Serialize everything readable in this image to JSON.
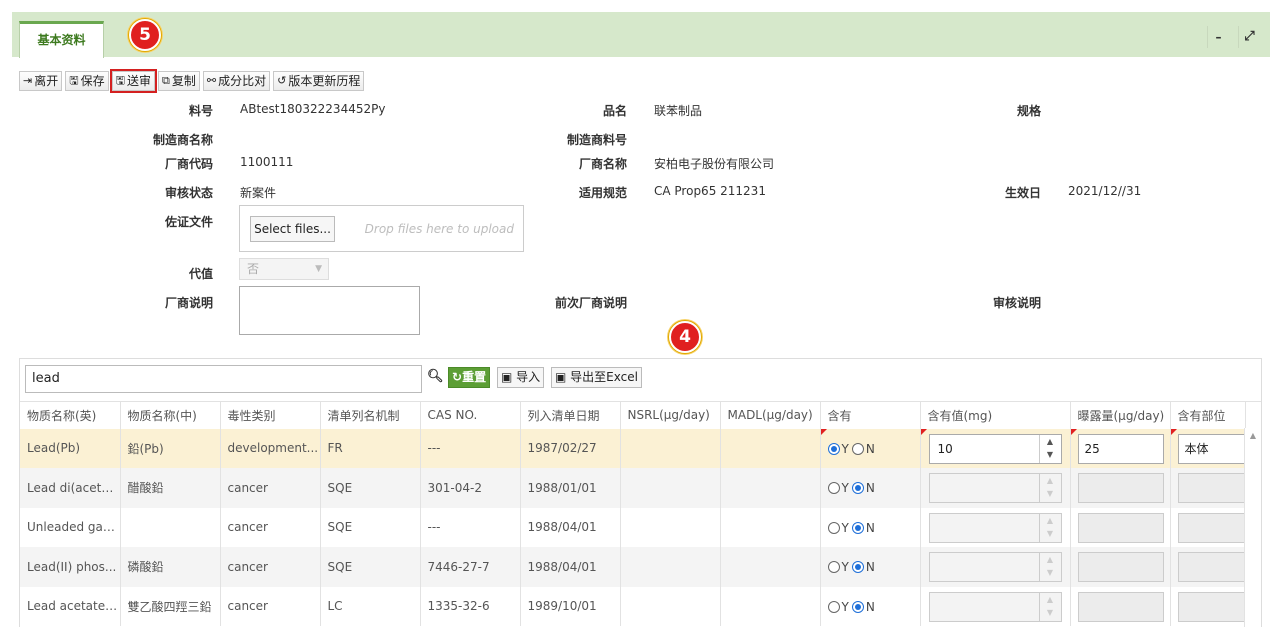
{
  "tab": {
    "label": "基本资料"
  },
  "badges": {
    "five": "5",
    "four": "4"
  },
  "window": {
    "minimize": "–",
    "maximize": "⤢"
  },
  "toolbar": {
    "leave": "离开",
    "save": "保存",
    "submit": "送审",
    "copy": "复制",
    "compare": "成分比对",
    "history": "版本更新历程"
  },
  "form": {
    "part_no_label": "料号",
    "part_no": "ABtest180322234452Py",
    "product_name_label": "品名",
    "product_name": "联苯制品",
    "spec_label": "规格",
    "maker_name_label": "制造商名称",
    "maker_part_label": "制造商料号",
    "vendor_code_label": "厂商代码",
    "vendor_code": "1100111",
    "vendor_name_label": "厂商名称",
    "vendor_name": "安柏电子股份有限公司",
    "review_status_label": "审核状态",
    "review_status": "新案件",
    "regulation_label": "适用规范",
    "regulation": "CA Prop65 211231",
    "effective_date_label": "生效日",
    "effective_date": "2021/12//31",
    "evidence_label": "佐证文件",
    "select_files": "Select files...",
    "drop_hint": "Drop files here to upload",
    "proxy_label": "代值",
    "proxy_value": "否",
    "vendor_note_label": "厂商说明",
    "prev_vendor_note_label": "前次厂商说明",
    "review_note_label": "审核说明"
  },
  "grid": {
    "search_value": "lead",
    "reset": "重置",
    "import": "导入",
    "export": "导出至Excel",
    "columns": [
      "物质名称(英)",
      "物质名称(中)",
      "毒性类别",
      "清单列名机制",
      "CAS NO.",
      "列入清单日期",
      "NSRL(μg/day)",
      "MADL(μg/day)",
      "含有",
      "含有值(mg)",
      "曝露量(μg/day)",
      "含有部位"
    ],
    "radio_y": "Y",
    "radio_n": "N",
    "rows": [
      {
        "en": "Lead(Pb)",
        "zh": "鉛(Pb)",
        "tox": "development...",
        "mech": "FR",
        "cas": "---",
        "date": "1987/02/27",
        "contains": "Y",
        "value": "10",
        "exposure": "25",
        "part": "本体"
      },
      {
        "en": "Lead di(acetate)",
        "zh": "醋酸鉛",
        "tox": "cancer",
        "mech": "SQE",
        "cas": "301-04-2",
        "date": "1988/01/01",
        "contains": "N",
        "value": "",
        "exposure": "",
        "part": ""
      },
      {
        "en": "Unleaded gas...",
        "zh": "",
        "tox": "cancer",
        "mech": "SQE",
        "cas": "---",
        "date": "1988/04/01",
        "contains": "N",
        "value": "",
        "exposure": "",
        "part": ""
      },
      {
        "en": "Lead(II) phos...",
        "zh": "磷酸鉛",
        "tox": "cancer",
        "mech": "SQE",
        "cas": "7446-27-7",
        "date": "1988/04/01",
        "contains": "N",
        "value": "",
        "exposure": "",
        "part": ""
      },
      {
        "en": "Lead acetate,...",
        "zh": "雙乙酸四羥三鉛",
        "tox": "cancer",
        "mech": "LC",
        "cas": "1335-32-6",
        "date": "1989/10/01",
        "contains": "N",
        "value": "",
        "exposure": "",
        "part": ""
      }
    ]
  }
}
